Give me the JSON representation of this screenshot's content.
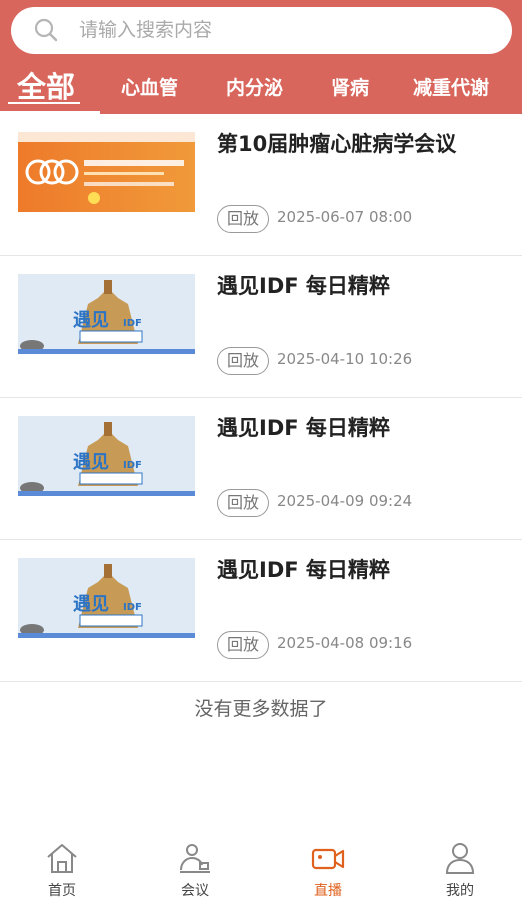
{
  "search": {
    "placeholder": "请输入搜索内容"
  },
  "tabs": [
    {
      "label": "全部",
      "active": true
    },
    {
      "label": "心血管"
    },
    {
      "label": "内分泌"
    },
    {
      "label": "肾病"
    },
    {
      "label": "减重代谢"
    }
  ],
  "list": [
    {
      "title": "第10届肿瘤心脏病学会议",
      "badge": "回放",
      "time": "2025-06-07 08:00",
      "thumb": {
        "line1": "第10届肿瘤心脏病学会议",
        "year": "2025"
      }
    },
    {
      "title": "遇见IDF 每日精粹",
      "badge": "回放",
      "time": "2025-04-10 10:26",
      "thumb": {
        "line1": "遇见 IDF",
        "line2": "每日精粹 直播间"
      }
    },
    {
      "title": "遇见IDF 每日精粹",
      "badge": "回放",
      "time": "2025-04-09 09:24",
      "thumb": {
        "line1": "遇见 IDF",
        "line2": "每日精粹 直播间"
      }
    },
    {
      "title": "遇见IDF 每日精粹",
      "badge": "回放",
      "time": "2025-04-08 09:16",
      "thumb": {
        "line1": "遇见 IDF",
        "line2": "每日精粹 直播间"
      }
    }
  ],
  "footer_text": "没有更多数据了",
  "bottom_nav": [
    {
      "label": "首页",
      "icon": "home-icon"
    },
    {
      "label": "会议",
      "icon": "meeting-icon"
    },
    {
      "label": "直播",
      "icon": "live-video-icon",
      "active": true
    },
    {
      "label": "我的",
      "icon": "user-icon"
    }
  ],
  "colors": {
    "header": "#d9665c",
    "accent": "#e0611e"
  }
}
